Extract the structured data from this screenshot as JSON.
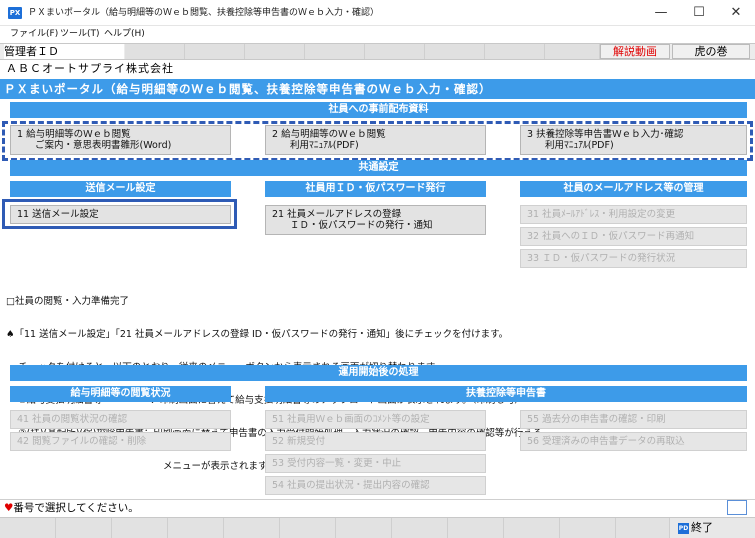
{
  "window": {
    "app_icon_text": "PX",
    "title": "ＰＸまいポータル（給与明細等のＷｅｂ閲覧、扶養控除等申告書のＷｅｂ入力・確認）",
    "minimize": "—",
    "maximize": "☐",
    "close": "✕"
  },
  "menu": [
    "ファイル(F)",
    "ツール(T)",
    "ヘルプ(H)"
  ],
  "topbar": {
    "admin": "管理者ＩＤ",
    "kaisetsu": "解説動画",
    "tora": "虎の巻"
  },
  "company": "ＡＢＣオートサプライ株式会社",
  "portal_header": "ＰＸまいポータル（給与明細等のＷｅｂ閲覧、扶養控除等申告書のＷｅｂ入力・確認）",
  "pre_distribution": {
    "heading": "社員への事前配布資料",
    "buttons": [
      {
        "line1": "1 給与明細等のＷｅｂ閲覧",
        "line2": "ご案内・意思表明書雛形(Word)"
      },
      {
        "line1": "2 給与明細等のＷｅｂ閲覧",
        "line2": "利用ﾏﾆｭｱﾙ(PDF)"
      },
      {
        "line1": "3 扶養控除等申告書Ｗｅｂ入力･確認",
        "line2": "利用ﾏﾆｭｱﾙ(PDF)"
      }
    ]
  },
  "common": {
    "heading": "共通設定",
    "mail": {
      "heading": "送信メール設定",
      "button": "11 送信メール設定"
    },
    "id_issue": {
      "heading": "社員用ＩＤ・仮パスワード発行",
      "line1": "21 社員メールアドレスの登録",
      "line2": "ＩＤ・仮パスワードの発行・通知"
    },
    "mail_manage": {
      "heading": "社員のメールアドレス等の管理",
      "buttons": [
        "31 社員ﾒｰﾙｱﾄﾞﾚｽ・利用設定の変更",
        "32 社員へのＩＤ・仮パスワード再通知",
        "33 ＩＤ・仮パスワードの発行状況"
      ]
    }
  },
  "notes": {
    "checkbox": "□社員の閲覧・入力準備完了",
    "line1": "♠「11 送信メール設定」「21 社員メールアドレスの登録 ID・仮パスワードの発行・通知」後にチェックを付けます。",
    "line2": "    チェックを付けると、以下のとおり、従来のメニューボタンから表示される画面が切り替わります。",
    "line3": "    ①給与支払明細書等　　　　　：印刷画面に替えて給与支払明細書等のアップロード画面が表示されます。（印刷も可）",
    "line4": "    ②(扶)(基配所)(保)控除申告書：印刷画面に替えて申告書の入力受付開始処理、入力状況の確認、申告内容の確認等が行える",
    "line5": "                                                    メニューが表示されます。（印刷も可）"
  },
  "operation": {
    "heading": "運用開始後の処理",
    "pay": {
      "heading": "給与明細等の閲覧状況",
      "buttons": [
        "41 社員の閲覧状況の確認",
        "42 閲覧ファイルの確認・削除"
      ]
    },
    "deduction": {
      "heading": "扶養控除等申告書",
      "mid_buttons": [
        "51 社員用Ｗｅｂ画面のｺﾒﾝﾄ等の設定",
        "52 新規受付",
        "53 受付内容一覧・変更・中止",
        "54 社員の提出状況・提出内容の確認"
      ],
      "right_buttons": [
        "55 過去分の申告書の確認・印刷",
        "56 受理済みの申告書データの再取込"
      ]
    }
  },
  "status": {
    "text": "番号で選択してください。",
    "heart": "♥"
  },
  "bottom": {
    "end_icon": "PD",
    "end_label": "終了"
  }
}
